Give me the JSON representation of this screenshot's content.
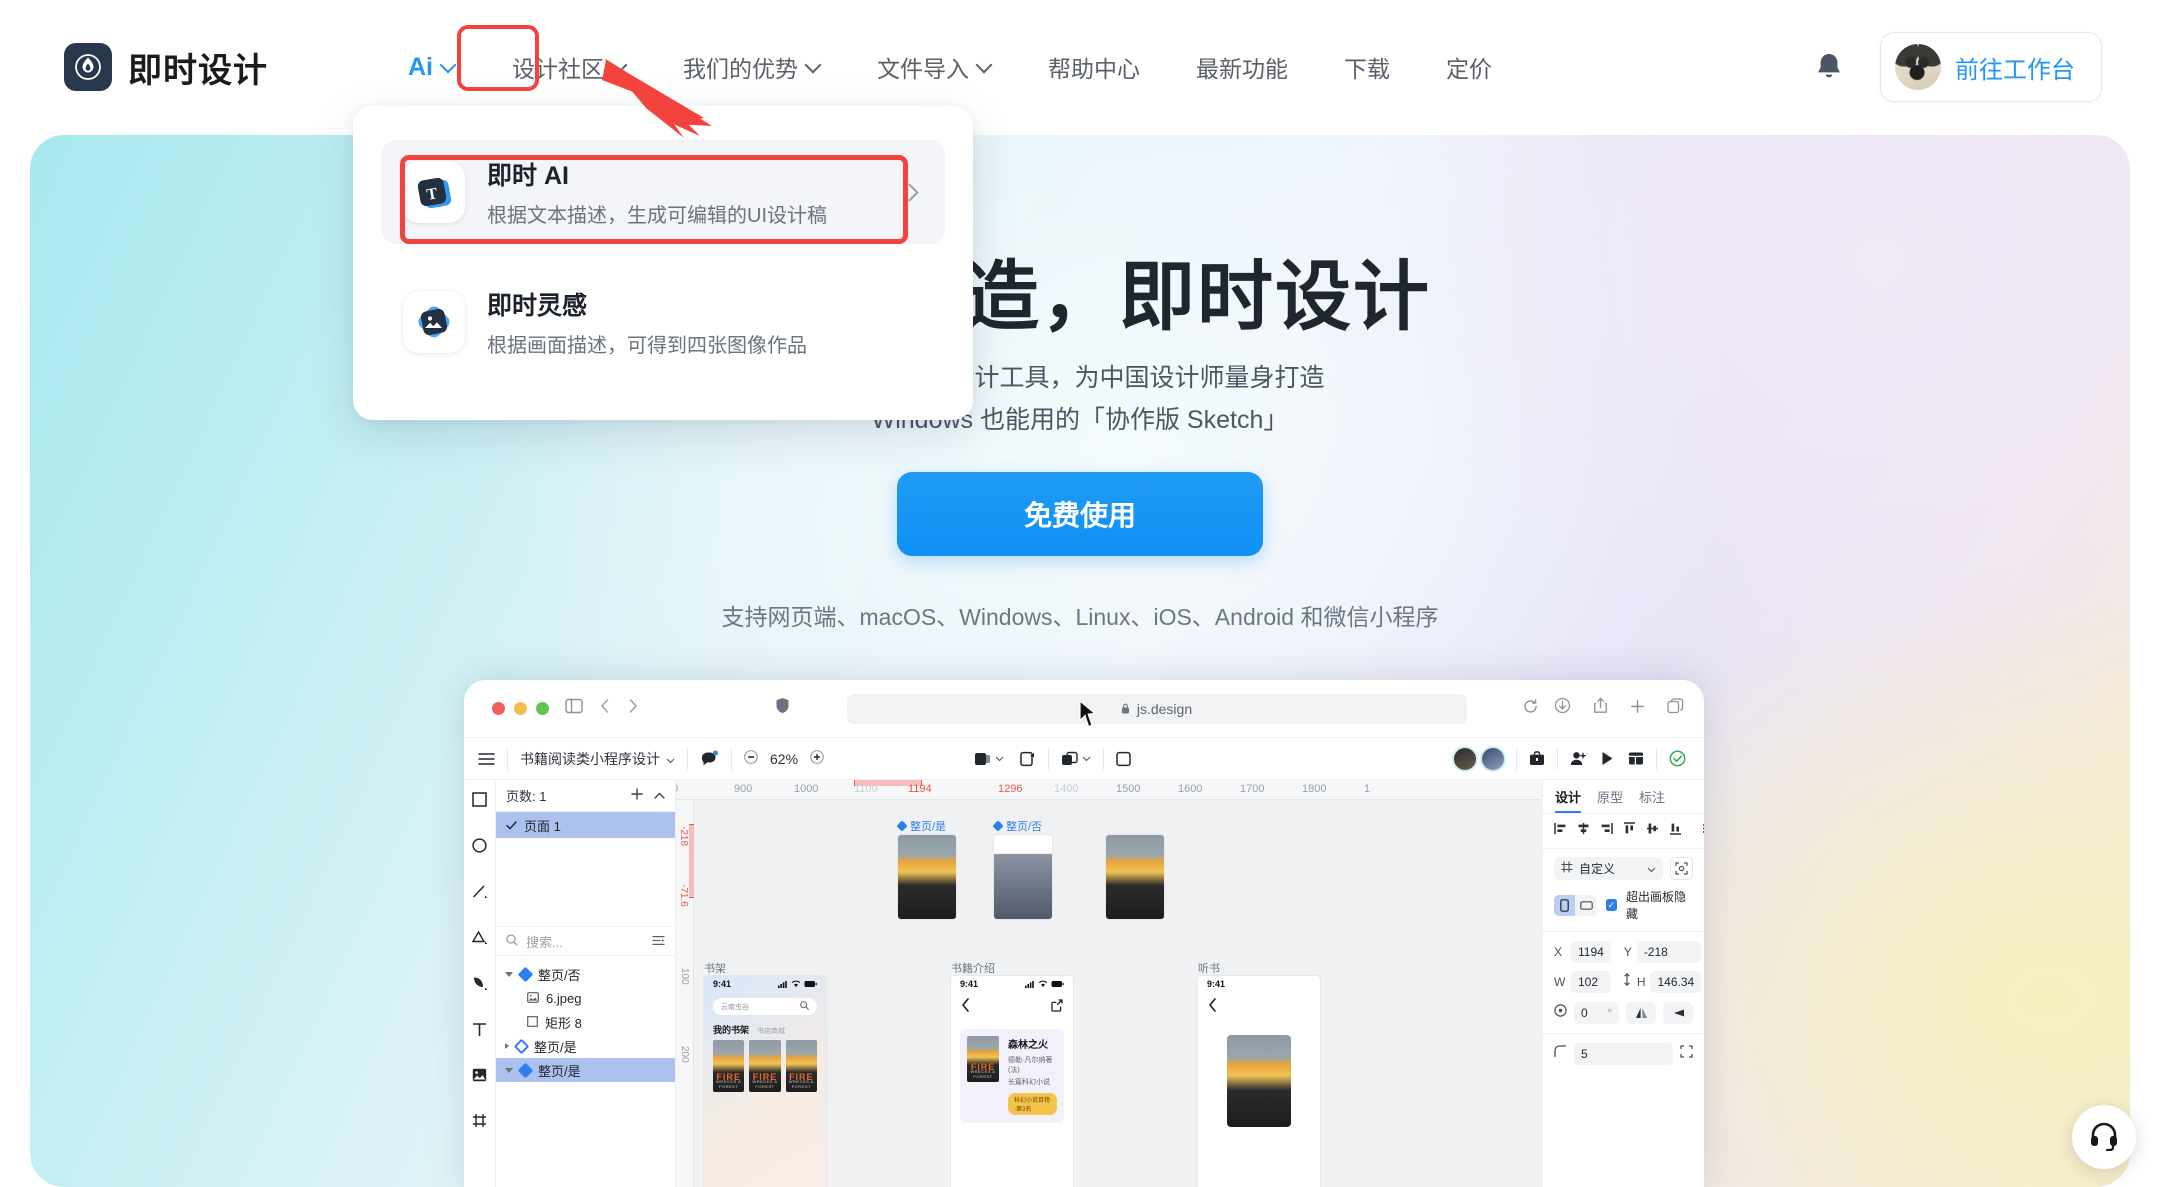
{
  "header": {
    "brand": "即时设计",
    "brand_icon": "flame-logo-icon",
    "nav": [
      {
        "label": "Ai",
        "has_caret": true,
        "highlighted": true
      },
      {
        "label": "设计社区",
        "has_caret": true
      },
      {
        "label": "我们的优势",
        "has_caret": true
      },
      {
        "label": "文件导入",
        "has_caret": true
      },
      {
        "label": "帮助中心",
        "has_caret": false
      },
      {
        "label": "最新功能",
        "has_caret": false
      },
      {
        "label": "下载",
        "has_caret": false
      },
      {
        "label": "定价",
        "has_caret": false
      }
    ],
    "bell_icon": "notification-bell-icon",
    "workbench_label": "前往工作台",
    "avatar_icon": "user-avatar"
  },
  "dropdown": {
    "items": [
      {
        "title": "即时 AI",
        "desc": "根据文本描述，生成可编辑的UI设计稿",
        "icon": "text-to-ui-icon",
        "active": true,
        "arrow": "chevron-right-icon"
      },
      {
        "title": "即时灵感",
        "desc": "根据画面描述，可得到四张图像作品",
        "icon": "image-generate-icon",
        "active": false
      }
    ]
  },
  "hero": {
    "title": "即时创造，即时设计",
    "subtitle_line1": "专业级 UI 设计工具，为中国设计师量身打造",
    "subtitle_line2": "Windows 也能用的「协作版 Sketch」",
    "cta": "免费使用",
    "platforms": "支持网页端、macOS、Windows、Linux、iOS、Android 和微信小程序"
  },
  "mock": {
    "browser": {
      "url": "js.design",
      "lock_icon": "lock-icon",
      "sidebar_icon": "sidebar-toggle-icon",
      "back_icon": "chevron-left-icon",
      "forward_icon": "chevron-right-icon",
      "shield_icon": "shield-icon",
      "reload_icon": "reload-icon",
      "download_icon": "download-icon",
      "share_icon": "share-icon",
      "newtab_icon": "plus-icon",
      "tabs_icon": "copy-tabs-icon"
    },
    "toolbar": {
      "menu_icon": "hamburger-menu-icon",
      "file_name": "书籍阅读类小程序设计",
      "zoom": "62%",
      "zoom_out_icon": "minus-icon",
      "zoom_in_icon": "plus-icon",
      "comment_icon": "comment-icon",
      "frame_icon": "frame-tool-icon",
      "component_icon": "component-icon",
      "mask_icon": "mask-icon",
      "slice_icon": "slice-icon",
      "assets_icon": "assets-icon",
      "invite_icon": "invite-user-icon",
      "present_icon": "play-icon",
      "layout_icon": "layout-icon",
      "status_icon": "check-circle-icon"
    },
    "tools": [
      "rectangle-tool-icon",
      "ellipse-tool-icon",
      "line-tool-icon",
      "polygon-tool-icon",
      "pen-tool-icon",
      "text-tool-icon",
      "image-tool-icon",
      "frame-tool-icon"
    ],
    "layers": {
      "pages_label": "页数: 1",
      "add_icon": "plus-icon",
      "collapse_icon": "chevron-up-icon",
      "page_name": "页面 1",
      "check_icon": "check-icon",
      "search_placeholder": "搜索...",
      "search_icon": "search-icon",
      "filter_icon": "filter-icon",
      "tree": [
        {
          "name": "整页/否",
          "icon": "component-diamond-icon",
          "depth": 0,
          "expanded": true,
          "selected": false
        },
        {
          "name": "6.jpeg",
          "icon": "image-icon",
          "depth": 1,
          "selected": false
        },
        {
          "name": "矩形 8",
          "icon": "rectangle-icon",
          "depth": 1,
          "selected": false
        },
        {
          "name": "整页/是",
          "icon": "component-instance-icon",
          "depth": 0,
          "expanded": false,
          "selected": false
        },
        {
          "name": "整页/是",
          "icon": "component-diamond-icon",
          "depth": 0,
          "expanded": true,
          "selected": true
        }
      ]
    },
    "canvas": {
      "ruler_h_ticks": [
        "900",
        "1000",
        "1100",
        "1194",
        "1296",
        "1400",
        "1500",
        "1600",
        "1700",
        "1800"
      ],
      "ruler_h_highlight": [
        "1194",
        "1296"
      ],
      "ruler_v_ticks": [
        "-218",
        "-71.6",
        "100",
        "200"
      ],
      "ruler_v_highlight": [
        "-218",
        "-71.6"
      ],
      "frames": [
        {
          "label": "整页/是",
          "kind": "component"
        },
        {
          "label": "整页/否",
          "kind": "component"
        },
        {
          "label": "书架",
          "kind": "frame"
        },
        {
          "label": "书籍介绍",
          "kind": "frame"
        },
        {
          "label": "听书",
          "kind": "frame"
        }
      ],
      "phone": {
        "time": "9:41",
        "search_value": "云南虫谷",
        "shelf_tab_primary": "我的书架",
        "shelf_tab_secondary": "书店商城",
        "cover_title": "FIRE",
        "cover_sub": "WRECKS A FOREST",
        "book_title": "森林之火",
        "book_author": "德勒·凡尔纳著(法)",
        "book_genre": "长篇科幻小说",
        "book_badge": "科幻小说目榜·第3名",
        "back_icon": "chevron-left-icon",
        "share_icon": "external-link-icon",
        "signal_icon": "signal-icon",
        "wifi_icon": "wifi-icon",
        "battery_icon": "battery-icon",
        "search_icon": "search-icon"
      }
    },
    "props": {
      "tabs": [
        "设计",
        "原型",
        "标注"
      ],
      "active_tab": "设计",
      "align_icons": [
        "align-left-icon",
        "align-center-h-icon",
        "align-right-icon",
        "align-top-icon",
        "align-middle-v-icon",
        "align-bottom-icon",
        "distribute-icon"
      ],
      "preset_label": "自定义",
      "preset_icon": "resize-icon",
      "preset_caret": "chevron-down-icon",
      "scale_icon": "scale-to-fit-icon",
      "orientation_portrait_icon": "portrait-icon",
      "orientation_landscape_icon": "landscape-icon",
      "clip_label": "超出画板隐藏",
      "clip_checked": true,
      "fields": {
        "x_label": "X",
        "x_value": "1194",
        "y_label": "Y",
        "y_value": "-218",
        "w_label": "W",
        "w_value": "102",
        "h_label": "H",
        "h_value": "146.34",
        "link_icon": "link-ratio-icon",
        "rotation_icon": "rotation-icon",
        "rotation_value": "0",
        "rotation_unit": "°",
        "flip_h_icon": "flip-horizontal-icon",
        "flip_v_icon": "flip-vertical-icon",
        "radius_icon": "corner-radius-icon",
        "radius_value": "5",
        "radius_expand_icon": "independent-corners-icon"
      }
    }
  },
  "support": {
    "icon": "headset-support-icon"
  },
  "annotations": {
    "arrow_icon": "red-pointer-arrow",
    "highlight_color": "#f4433d"
  }
}
